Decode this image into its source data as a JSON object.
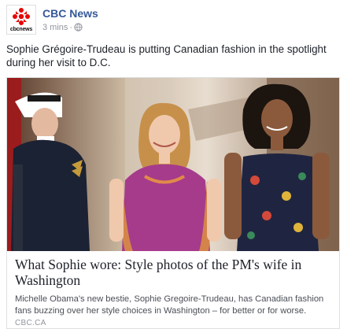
{
  "post": {
    "page_name": "CBC News",
    "logo_text": "cbcnews",
    "timestamp": "3 mins",
    "separator": "·",
    "privacy_icon": "globe-icon",
    "message": "Sophie Grégoire-Trudeau is putting Canadian fashion in the spotlight during her visit to D.C."
  },
  "link": {
    "image_icon": "photo-guard-sophie-michelle",
    "title": "What Sophie wore: Style photos of the PM's wife in Washington",
    "description": "Michelle Obama's new bestie, Sophie Gregoire-Trudeau, has Canadian fashion fans buzzing over her style choices in Washington – for better or for worse.",
    "domain": "cbc.ca"
  },
  "colors": {
    "brand_red": "#e60505",
    "link_blue": "#365899",
    "meta_gray": "#90949c"
  }
}
